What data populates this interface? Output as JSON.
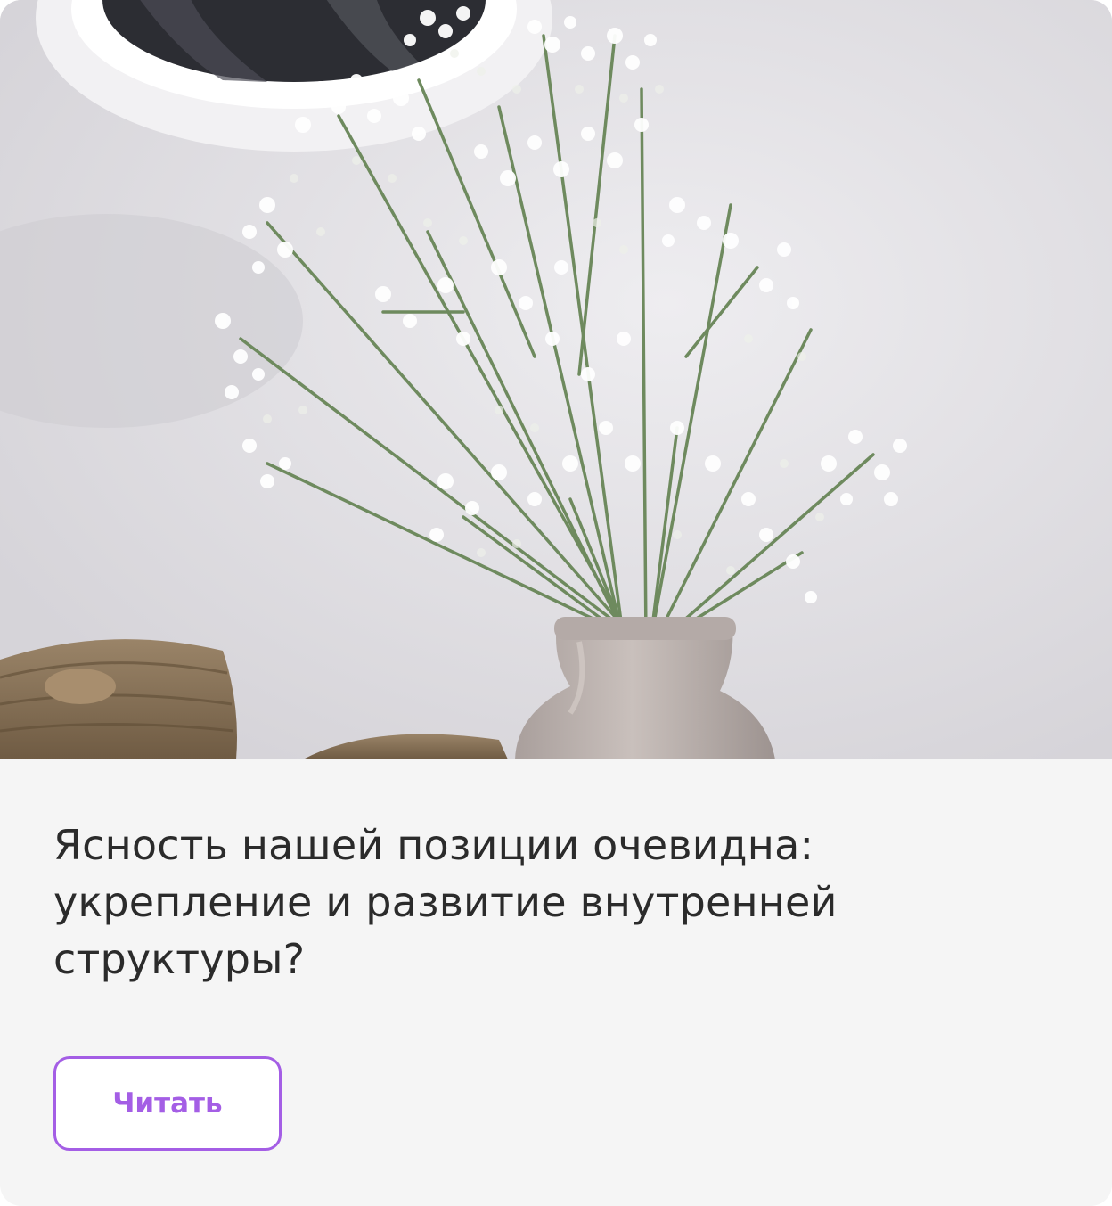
{
  "card": {
    "title": "Ясность нашей позиции очевидна: укрепление и развитие внутренней структуры?",
    "read_button_label": "Читать",
    "accent_color": "#a45ee5"
  }
}
